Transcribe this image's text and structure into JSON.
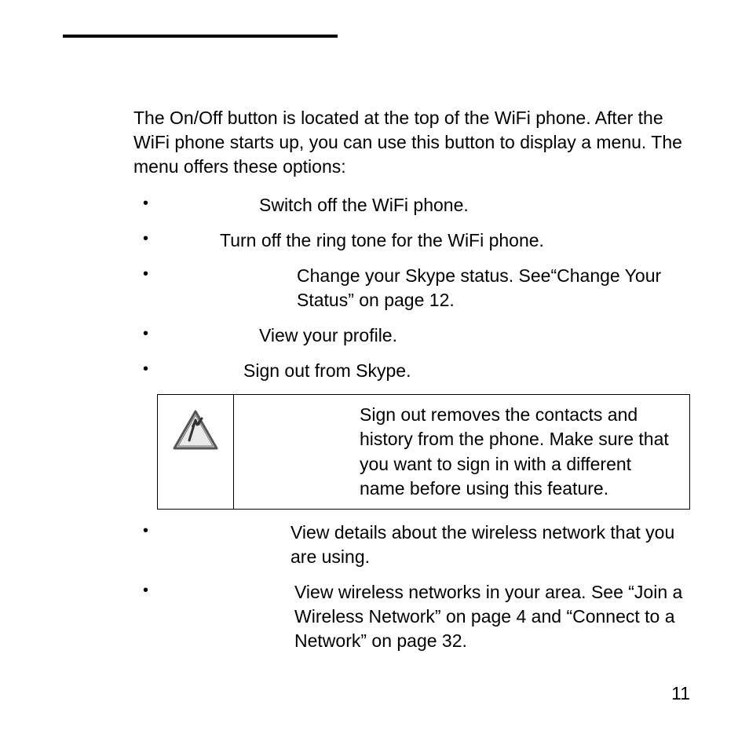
{
  "intro": "The On/Off button is located at the top of the WiFi phone. After the WiFi phone starts up, you can use this button to display a menu. The menu offers these options:",
  "items": {
    "switch_off": "Switch off the WiFi phone.",
    "silent": "Turn off the ring tone for the WiFi phone.",
    "change_status": "Change your Skype status. See“Change Your Status” on page 12.",
    "my_profile": "View your profile.",
    "sign_out": "Sign out from Skype.",
    "network_details": "View details about the wireless network that you are using.",
    "networks": "View wireless networks in your area. See “Join a Wireless Network” on page 4 and “Connect to a Network” on page 32."
  },
  "warning": {
    "text": "Sign out removes the contacts and history from the phone. Make sure that you want to sign in with a different name before using this feature."
  },
  "page_number": "11"
}
